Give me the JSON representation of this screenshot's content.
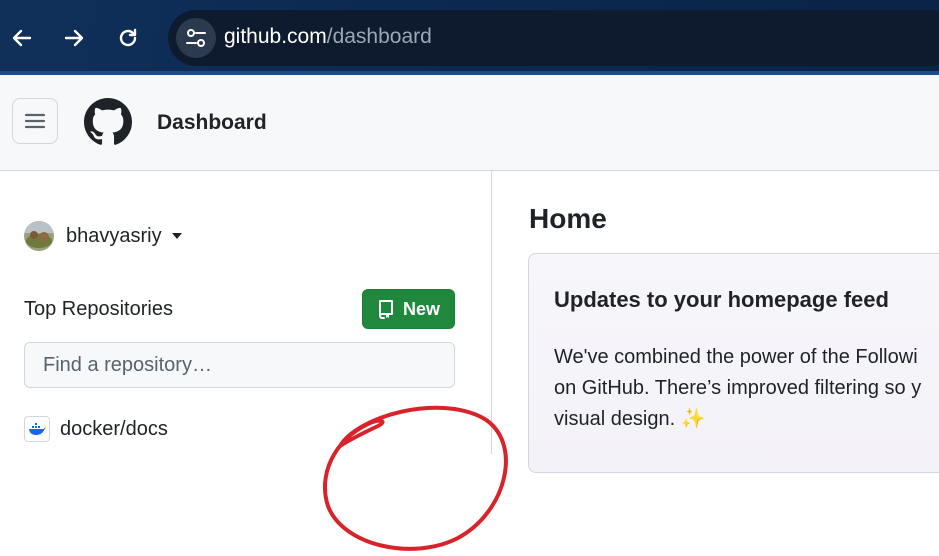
{
  "browser": {
    "url_host": "github.com",
    "url_path": "/dashboard"
  },
  "header": {
    "title": "Dashboard"
  },
  "sidebar": {
    "username": "bhavyasriy",
    "top_repositories_label": "Top Repositories",
    "new_button_label": "New",
    "find_placeholder": "Find a repository…",
    "repos": [
      {
        "name": "docker/docs"
      }
    ]
  },
  "main": {
    "title": "Home",
    "card": {
      "title": "Updates to your homepage feed",
      "body_lines": [
        "We've combined the power of the Followi",
        "on GitHub. There’s improved filtering so y",
        "visual design. ✨"
      ]
    }
  },
  "colors": {
    "new_button": "#1f883d",
    "annotation": "#d8232a",
    "browser_bar": "#0b2a52"
  }
}
